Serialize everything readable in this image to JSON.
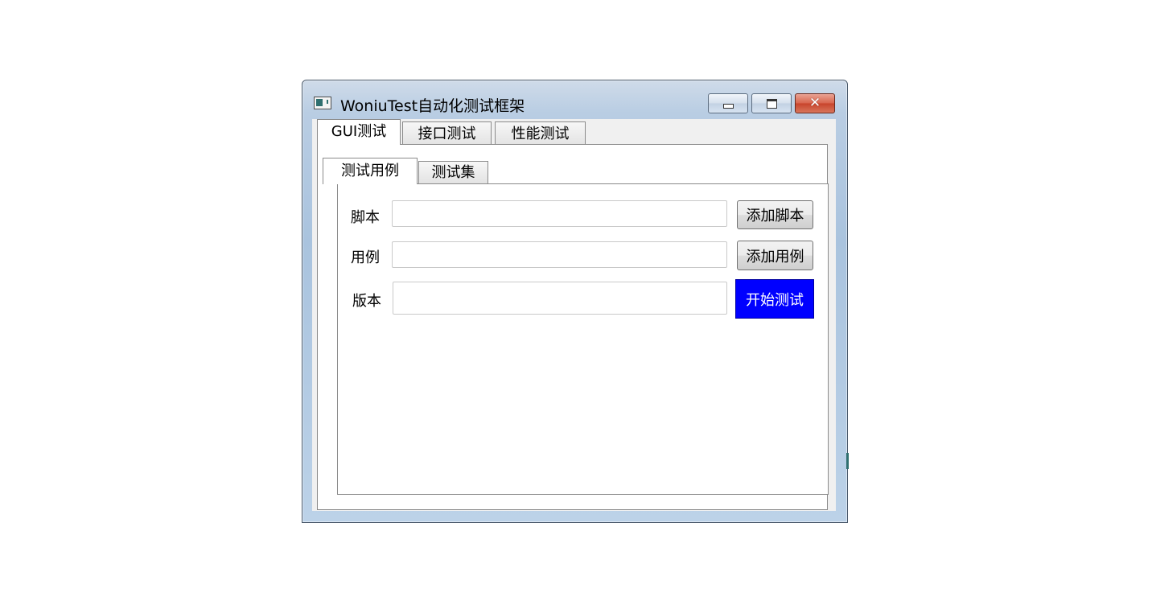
{
  "window": {
    "title": "WoniuTest自动化测试框架",
    "icon": "app-icon",
    "controls": {
      "minimize": "minimize-icon",
      "maximize": "maximize-icon",
      "close": "close-icon"
    }
  },
  "outer_tabs": [
    {
      "label": "GUI测试",
      "active": true
    },
    {
      "label": "接口测试",
      "active": false
    },
    {
      "label": "性能测试",
      "active": false
    }
  ],
  "inner_tabs": [
    {
      "label": "测试用例",
      "active": true
    },
    {
      "label": "测试集",
      "active": false
    }
  ],
  "form": {
    "script": {
      "label": "脚本",
      "value": "",
      "button": "添加脚本"
    },
    "case": {
      "label": "用例",
      "value": "",
      "button": "添加用例"
    },
    "version": {
      "label": "版本",
      "value": "",
      "button": "开始测试"
    }
  },
  "colors": {
    "start_button_bg": "#0000ff",
    "start_button_text": "#ffffff"
  }
}
